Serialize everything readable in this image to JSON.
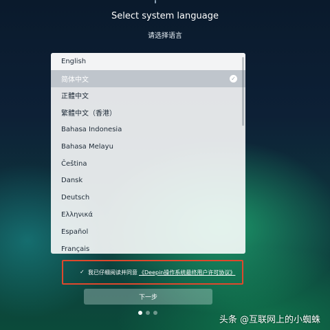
{
  "header": {
    "title": "Select system language",
    "subtitle": "请选择语言"
  },
  "languages": {
    "selected_index": 1,
    "items": [
      "English",
      "简体中文",
      "正體中文",
      "繁體中文（香港）",
      "Bahasa Indonesia",
      "Bahasa Melayu",
      "Čeština",
      "Dansk",
      "Deutsch",
      "Ελληνικά",
      "Español",
      "Français"
    ]
  },
  "agreement": {
    "checked": true,
    "check_glyph": "✓",
    "text": "我已仔细阅读并同意",
    "link": "《Deepin操作系统最终用户许可协议》",
    "highlight_color": "#e0482c"
  },
  "next_button": {
    "label": "下一步"
  },
  "pagination": {
    "total": 3,
    "current": 1
  },
  "watermark": {
    "text": "头条 @互联网上的小蜘蛛"
  },
  "icons": {
    "selected": "check-circle-icon",
    "checkbox": "checkbox-icon"
  }
}
